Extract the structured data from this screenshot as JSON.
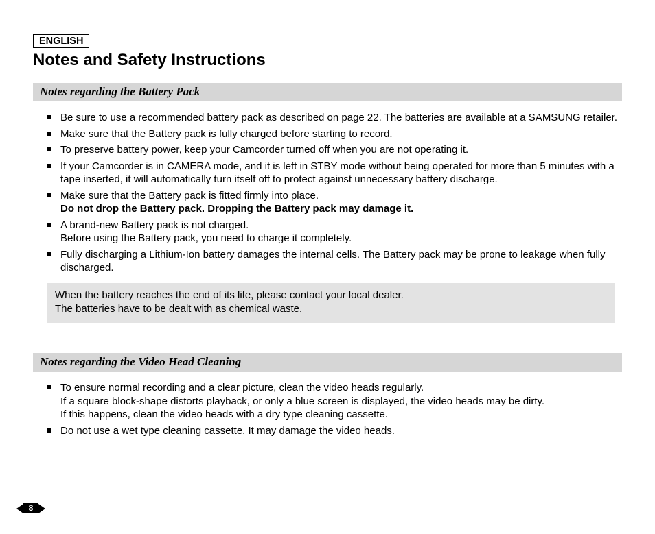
{
  "header": {
    "language": "ENGLISH",
    "title": "Notes and Safety Instructions"
  },
  "sections": {
    "battery": {
      "heading": "Notes regarding the Battery Pack",
      "items": {
        "b1": "Be sure to use a recommended battery pack as described on page 22. The batteries are available at a SAMSUNG retailer.",
        "b2": "Make sure that the Battery pack is fully charged before starting to record.",
        "b3": "To preserve battery power, keep your Camcorder turned off when you are not operating it.",
        "b4": "If your Camcorder is in CAMERA mode, and it is left in STBY mode without being operated for more than 5 minutes with a tape inserted, it will automatically turn itself off to protect against unnecessary battery discharge.",
        "b5_line1": "Make sure that the Battery pack is fitted firmly into place.",
        "b5_line2": "Do not drop the Battery pack. Dropping the Battery pack may damage it.",
        "b6_line1": "A brand-new Battery pack is not charged.",
        "b6_line2": "Before using the Battery pack, you need to charge it completely.",
        "b7": "Fully discharging a Lithium-Ion battery damages the internal cells. The Battery pack may be prone to leakage when fully discharged."
      },
      "callout_line1": "When the battery reaches the end of its life, please contact your local dealer.",
      "callout_line2": "The batteries have to be dealt with as chemical waste."
    },
    "cleaning": {
      "heading": "Notes regarding the Video Head Cleaning",
      "items": {
        "c1_line1": "To ensure normal recording and a clear picture, clean the video heads regularly.",
        "c1_line2": "If a square block-shape distorts playback, or only a blue screen is displayed, the video heads may be dirty.",
        "c1_line3": "If this happens, clean the video heads with a dry type cleaning cassette.",
        "c2": "Do not use a wet type cleaning cassette. It may damage the video heads."
      }
    }
  },
  "page_number": "8"
}
